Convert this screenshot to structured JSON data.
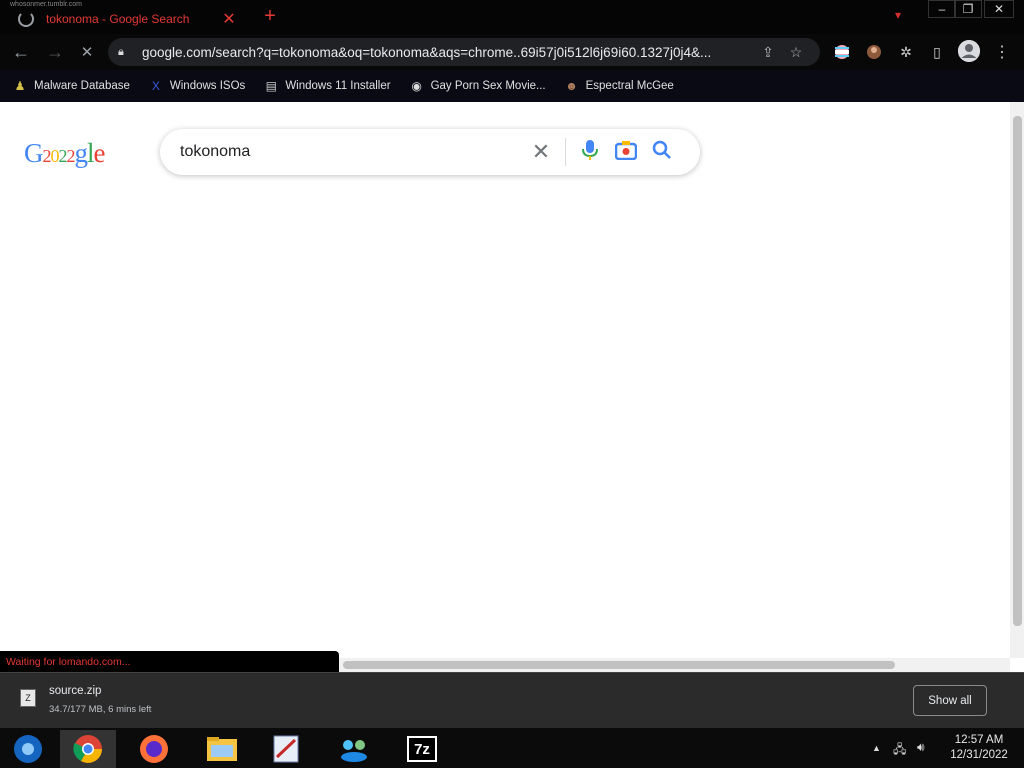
{
  "window": {
    "tab_title": "tokonoma - Google Search",
    "tab_close": "✕",
    "new_tab": "+",
    "faint_left": "whosonmer.tumblr.com",
    "minimize": "–",
    "maximize": "❐",
    "close": "✕"
  },
  "toolbar": {
    "back": "←",
    "forward": "→",
    "reload": "✕",
    "url": "google.com/search?q=tokonoma&oq=tokonoma&aqs=chrome..69i57j0i512l6j69i60.1327j0j4&..."
  },
  "bookmarks": [
    {
      "label": "Malware Database",
      "icon": "user-icon",
      "color": "#d4c04a"
    },
    {
      "label": "Windows ISOs",
      "icon": "x-logo-icon",
      "color": "#3b5bdb"
    },
    {
      "label": "Windows 11 Installer",
      "icon": "file-icon",
      "color": "#cccccc"
    },
    {
      "label": "Gay Porn Sex Movie...",
      "icon": "globe-icon",
      "color": "#dddddd"
    },
    {
      "label": "Espectral McGee",
      "icon": "avatar-icon",
      "color": "#b08060"
    }
  ],
  "search": {
    "query": "tokonoma",
    "logo_text": "G2022gle"
  },
  "status_bar": "Waiting for lomando.com...",
  "download": {
    "filename": "source.zip",
    "status": "34.7/177 MB, 6 mins left",
    "show_all": "Show all"
  },
  "taskbar": {
    "apps": [
      "chromium-icon",
      "chrome-icon",
      "firefox-icon",
      "file-explorer-icon",
      "paint-icon",
      "network-people-icon",
      "7zip-icon"
    ],
    "sevenzip_label": "7z"
  },
  "clock": {
    "time": "12:57 AM",
    "date": "12/31/2022"
  },
  "colors": {
    "accent_red": "#e53935",
    "google_blue": "#4285f4",
    "google_red": "#ea4335",
    "google_yellow": "#fbbc05",
    "google_green": "#34a853"
  }
}
